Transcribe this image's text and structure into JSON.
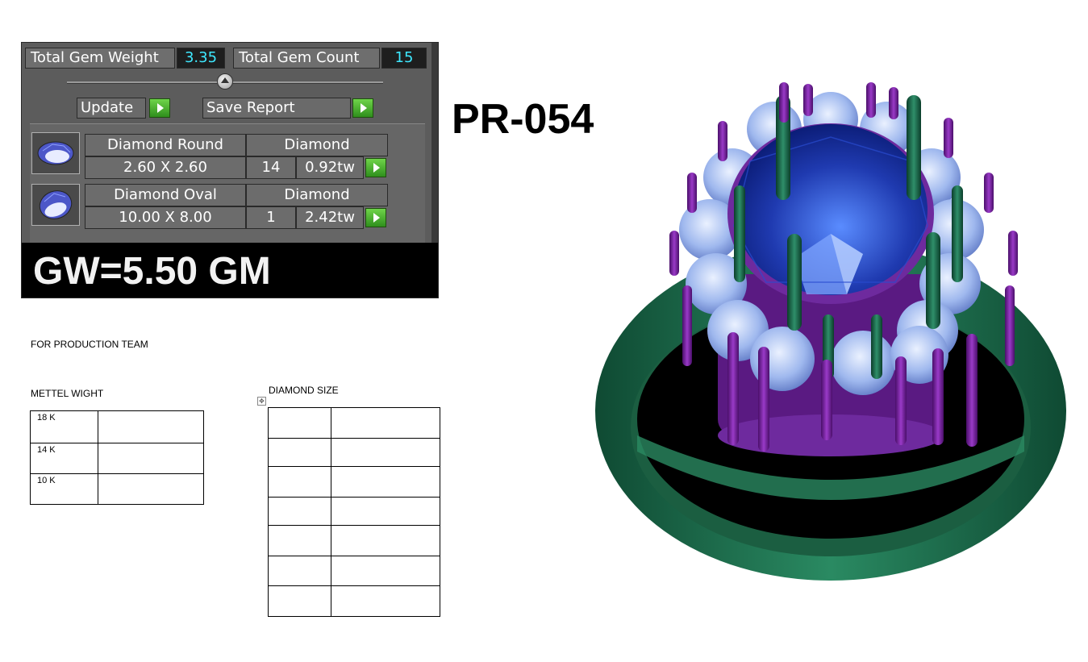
{
  "summary": {
    "total_weight_label": "Total Gem Weight",
    "total_weight_value": "3.35",
    "total_count_label": "Total Gem Count",
    "total_count_value": "15"
  },
  "actions": {
    "update_label": "Update",
    "save_report_label": "Save Report"
  },
  "gems": [
    {
      "shape": "Diamond Round",
      "material": "Diamond",
      "size": "2.60 X 2.60",
      "count": "14",
      "weight": "0.92tw",
      "icon": "round-diamond-icon"
    },
    {
      "shape": "Diamond Oval",
      "material": "Diamond",
      "size": "10.00 X 8.00",
      "count": "1",
      "weight": "2.42tw",
      "icon": "oval-diamond-icon"
    }
  ],
  "gross_weight": "GW=5.50 GM",
  "product_code": "PR-054",
  "production_note": "FOR PRODUCTION TEAM",
  "metal_weight": {
    "heading": "METTEL WIGHT",
    "rows": [
      "18 K",
      "14 K",
      "10 K"
    ]
  },
  "diamond_size": {
    "heading": "DIAMOND SIZE"
  },
  "colors": {
    "panel_bg": "#5c5c5c",
    "value_text": "#3ee8ff",
    "play_green": "#3fa82a",
    "ring_band": "#1f6b4a",
    "ring_prongs": "#7a1f9e",
    "center_stone": "#1f3ab0",
    "side_stones": "#9fb8ee"
  }
}
